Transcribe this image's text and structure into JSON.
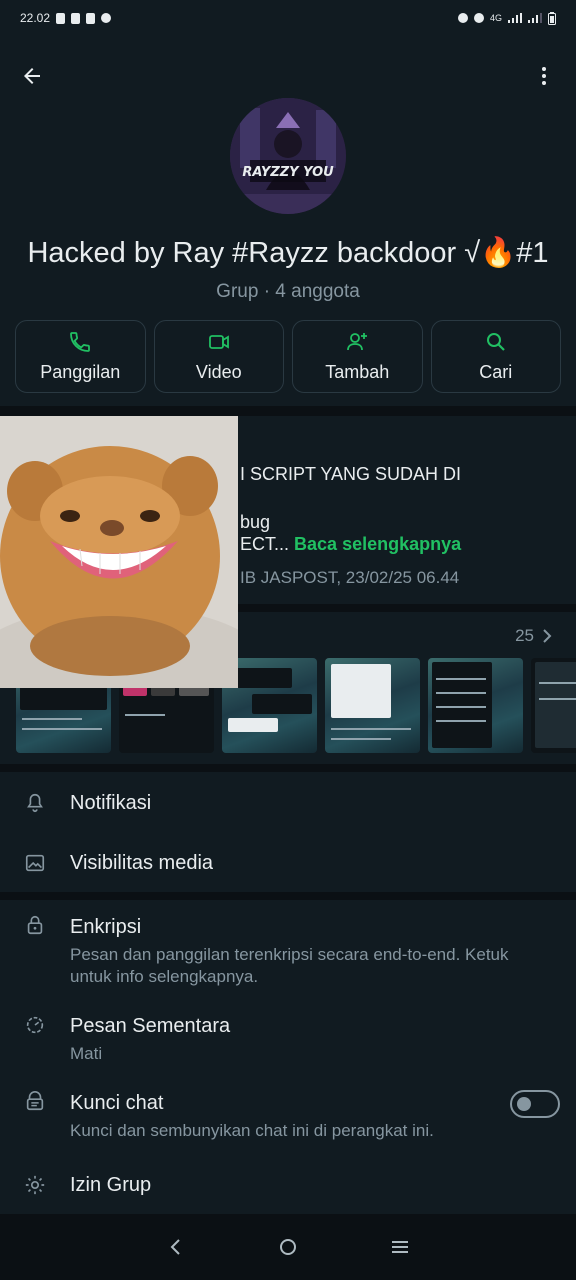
{
  "status_bar": {
    "time": "22.02",
    "network": "4G"
  },
  "header": {
    "group_name": "Hacked by Ray #Rayzz backdoor √🔥#1",
    "group_sub": "Grup · 4 anggota",
    "avatar_text": "RAYZZY YOU"
  },
  "actions": [
    {
      "label": "Panggilan",
      "icon": "phone-icon"
    },
    {
      "label": "Video",
      "icon": "video-icon"
    },
    {
      "label": "Tambah",
      "icon": "add-person-icon"
    },
    {
      "label": "Cari",
      "icon": "search-icon"
    }
  ],
  "description": {
    "line1": "I SCRIPT YANG SUDAH DI",
    "line2": "bug",
    "line3_prefix": "ECT...",
    "read_more": "Baca selengkapnya",
    "meta": "IB JASPOST, 23/02/25 06.44"
  },
  "media": {
    "count": "25"
  },
  "settings": {
    "notifications": "Notifikasi",
    "media_visibility": "Visibilitas media",
    "encryption_title": "Enkripsi",
    "encryption_sub": "Pesan dan panggilan terenkripsi secara end-to-end. Ketuk untuk info selengkapnya.",
    "disappearing_title": "Pesan Sementara",
    "disappearing_sub": "Mati",
    "chat_lock_title": "Kunci chat",
    "chat_lock_sub": "Kunci dan sembunyikan chat ini di perangkat ini.",
    "chat_lock_enabled": false,
    "group_permissions": "Izin Grup"
  },
  "colors": {
    "accent": "#21c063",
    "background": "#0b1014",
    "surface": "#111b21",
    "muted": "#8696a0"
  }
}
